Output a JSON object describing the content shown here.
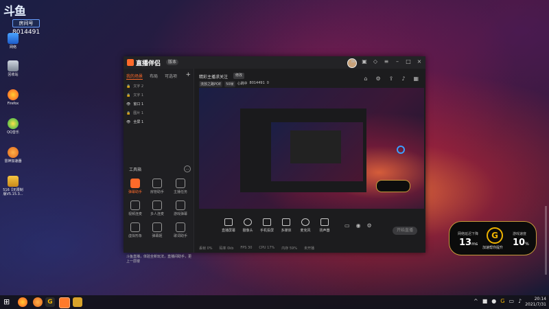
{
  "desktop": {
    "brand_logo": "斗鱼",
    "brand_tag": "房间号",
    "room_number": "8014491",
    "icons": [
      {
        "label": "网络",
        "icon": "network-icon"
      },
      {
        "label": "回收站",
        "icon": "recycle-bin-icon"
      },
      {
        "label": "Firefox",
        "icon": "firefox-icon"
      },
      {
        "label": "QQ音乐",
        "icon": "qq-music-icon"
      },
      {
        "label": "雷神加速器",
        "icon": "leishen-icon"
      },
      {
        "label": "516【无限制版V5.15.3...",
        "icon": "archive-icon"
      }
    ]
  },
  "window": {
    "title": "直播伴侣",
    "version_badge": "版本",
    "left_tabs": [
      "我的场景",
      "布局",
      "可选项"
    ],
    "layers": [
      "文字 2",
      "文字 1",
      "窗口 1",
      "图片 1",
      "全屏 1"
    ],
    "tools_title": "工具箱",
    "tools": [
      "弹幕助手",
      "房管助手",
      "主播任务",
      "视频连麦",
      "多人连麦",
      "游戏弹幕",
      "虚拟形象",
      "弹幕姬",
      "歌词助手"
    ],
    "marquee": "斗鱼直播，体验全新玩法，直播间助手，更上一层楼",
    "room_title": "精彩主播求关注",
    "room_btn": "修改",
    "meta_tags": [
      "流放之路POE",
      "50帧",
      "心跳中",
      "8014491",
      "0"
    ],
    "bottom_buttons": [
      "直播屏幕",
      "摄像头",
      "手机投屏",
      "多媒体",
      "麦克风",
      "扬声器"
    ],
    "start_label": "开始直播",
    "status": [
      "丢帧 0%",
      "码率 0kb",
      "FPS 30",
      "CPU 17%",
      "内存 59%",
      "未开播"
    ]
  },
  "speed_widget": {
    "left_label": "网络延迟下降",
    "left_value": "13",
    "left_unit": "ms",
    "right_label": "游戏速度",
    "right_value": "10",
    "right_unit": "%",
    "logo": "G",
    "caption": "加速帮你提升"
  },
  "taskbar": {
    "time": "20:14",
    "date": "2021/7/31"
  }
}
